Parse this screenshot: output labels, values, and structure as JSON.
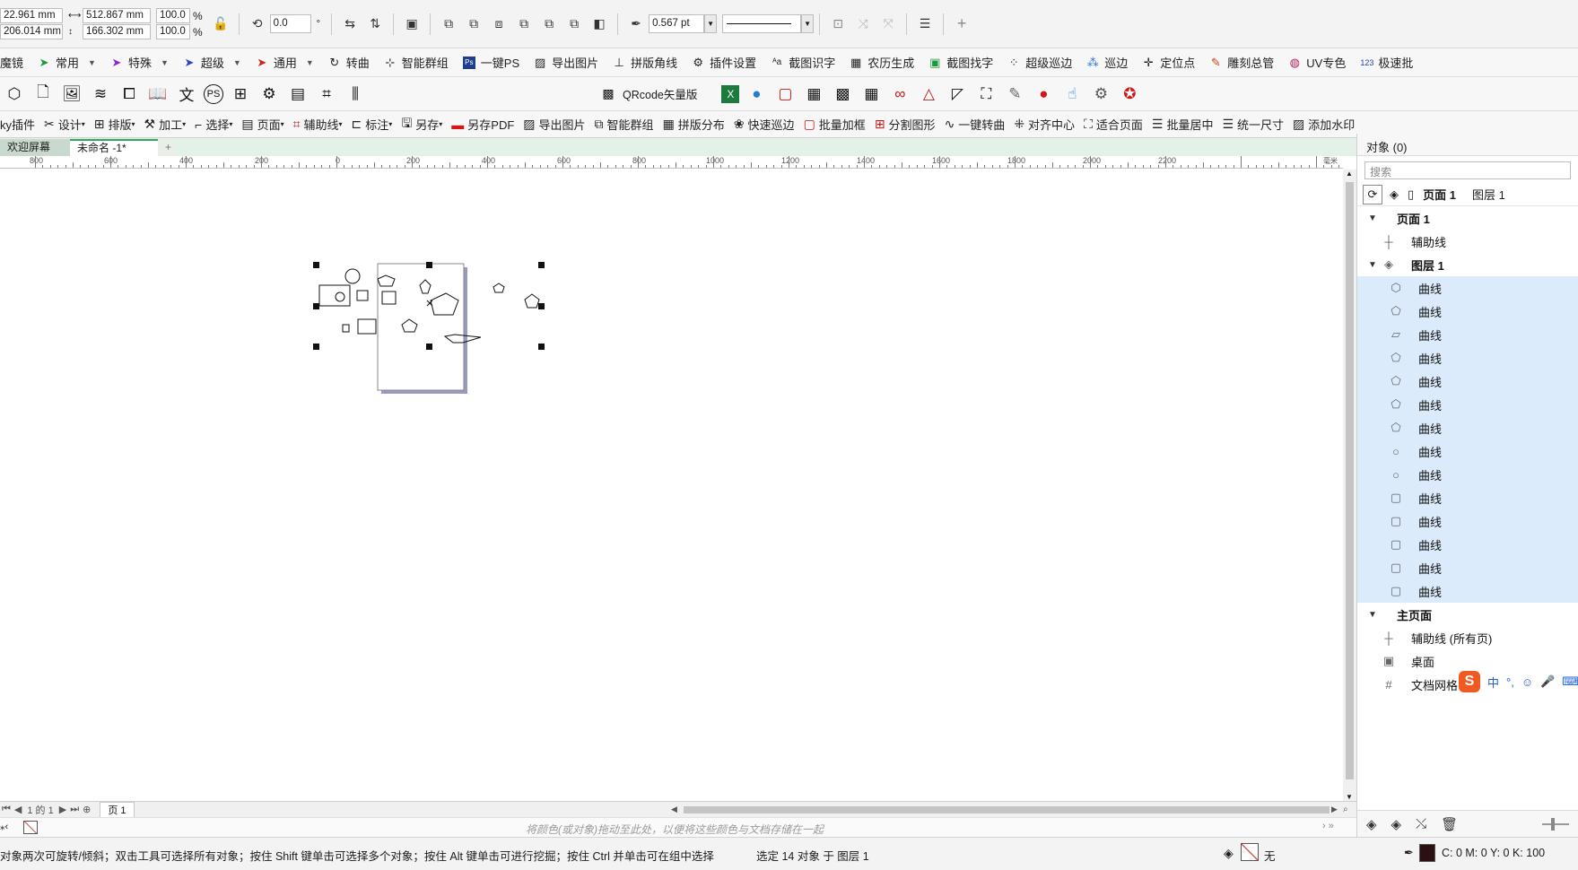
{
  "prop_bar": {
    "x": "22.961 mm",
    "y": "206.014 mm",
    "width": "512.867 mm",
    "height": "166.302 mm",
    "scale_x": "100.0",
    "scale_y": "100.0",
    "percent": "%",
    "rotation": "0.0",
    "degree": "°",
    "outline_width": "0.567 pt",
    "plus": "+"
  },
  "plugin_bar": {
    "items": [
      {
        "label": "魔镜",
        "icon": "mirror-icon",
        "caret": false
      },
      {
        "label": "常用",
        "icon": "arrow-icon",
        "caret": true
      },
      {
        "label": "特殊",
        "icon": "arrow-icon",
        "caret": true
      },
      {
        "label": "超级",
        "icon": "arrow-icon",
        "caret": true
      },
      {
        "label": "通用",
        "icon": "arrow-icon",
        "caret": true
      },
      {
        "label": "转曲",
        "icon": "convert-icon",
        "caret": false
      },
      {
        "label": "智能群组",
        "icon": "group-icon",
        "caret": false
      },
      {
        "label": "一键PS",
        "icon": "ps-icon",
        "caret": false
      },
      {
        "label": "导出图片",
        "icon": "image-icon",
        "caret": false
      },
      {
        "label": "拼版角线",
        "icon": "cropmark-icon",
        "caret": false
      },
      {
        "label": "插件设置",
        "icon": "gear-icon",
        "caret": false
      },
      {
        "label": "截图识字",
        "icon": "ocr-icon",
        "caret": false
      },
      {
        "label": "农历生成",
        "icon": "calendar-icon",
        "caret": false
      },
      {
        "label": "截图找字",
        "icon": "find-text-icon",
        "caret": false
      },
      {
        "label": "超级巡边",
        "icon": "patrol-icon",
        "caret": false
      },
      {
        "label": "巡边",
        "icon": "patrol-small-icon",
        "caret": false
      },
      {
        "label": "定位点",
        "icon": "locate-icon",
        "caret": false
      },
      {
        "label": "雕刻总管",
        "icon": "engrave-icon",
        "caret": false
      },
      {
        "label": "UV专色",
        "icon": "uv-icon",
        "caret": false
      },
      {
        "label": "极速批",
        "icon": "batch-icon",
        "caret": false
      }
    ]
  },
  "icon_bar": {
    "qrcode_label": "QRcode矢量版"
  },
  "tools_bar": {
    "items": [
      {
        "label": "ky插件",
        "icon": ""
      },
      {
        "label": "设计",
        "icon": "design-icon",
        "caret": true
      },
      {
        "label": "排版",
        "icon": "layout-icon",
        "caret": true
      },
      {
        "label": "加工",
        "icon": "process-icon",
        "caret": true
      },
      {
        "label": "选择",
        "icon": "select-icon",
        "caret": true
      },
      {
        "label": "页面",
        "icon": "page-icon",
        "caret": true
      },
      {
        "label": "辅助线",
        "icon": "guide-icon",
        "caret": true
      },
      {
        "label": "标注",
        "icon": "dimension-icon",
        "caret": true
      },
      {
        "label": "另存",
        "icon": "saveas-icon",
        "caret": true
      },
      {
        "label": "另存PDF",
        "icon": "pdf-icon"
      },
      {
        "label": "导出图片",
        "icon": "image-icon"
      },
      {
        "label": "智能群组",
        "icon": "group-icon"
      },
      {
        "label": "拼版分布",
        "icon": "grid-icon"
      },
      {
        "label": "快速巡边",
        "icon": "patrol-icon"
      },
      {
        "label": "批量加框",
        "icon": "frame-icon"
      },
      {
        "label": "分割图形",
        "icon": "split-icon"
      },
      {
        "label": "一键转曲",
        "icon": "curve-icon"
      },
      {
        "label": "对齐中心",
        "icon": "align-center-icon"
      },
      {
        "label": "适合页面",
        "icon": "fit-page-icon"
      },
      {
        "label": "批量居中",
        "icon": "center-icon"
      },
      {
        "label": "统一尺寸",
        "icon": "resize-icon"
      },
      {
        "label": "添加水印",
        "icon": "watermark-icon"
      }
    ]
  },
  "doc_tabs": {
    "welcome": "欢迎屏幕",
    "current": "未命名 -1*",
    "add": "+"
  },
  "ruler": {
    "labels": [
      "800",
      "600",
      "400",
      "200",
      "0",
      "200",
      "400",
      "600",
      "800",
      "1000",
      "1200",
      "1400",
      "1600",
      "1800",
      "2000",
      "2200"
    ],
    "unit": "毫米"
  },
  "page_nav": {
    "page_of": "1 的 1",
    "page_tab": "页 1"
  },
  "palette_bar": {
    "hint": "将颜色(或对象)拖动至此处，以便将这些颜色与文档存储在一起"
  },
  "status_bar": {
    "hint": "对象两次可旋转/倾斜；双击工具可选择所有对象；按住 Shift 键单击可选择多个对象；按住 Alt 键单击可进行挖掘；按住 Ctrl 并单击可在组中选择",
    "selection": "选定 14 对象 于 图层 1",
    "fill_none": "无",
    "cmyk": "C: 0 M: 0 Y: 0 K: 100"
  },
  "objects_panel": {
    "title": "对象 (0)",
    "search_placeholder": "搜索",
    "page_label": "页面 1",
    "layer_label": "图层 1",
    "tree": [
      {
        "label": "页面 1",
        "level": 0,
        "bold": true,
        "twisty": "▼",
        "icon": "",
        "selected": false
      },
      {
        "label": "辅助线",
        "level": 1,
        "bold": false,
        "twisty": "",
        "icon": "guides-icon",
        "selected": false
      },
      {
        "label": "图层 1",
        "level": 0,
        "bold": true,
        "twisty": "▼",
        "icon": "layer-icon",
        "selected": false
      },
      {
        "label": "曲线",
        "level": 2,
        "bold": false,
        "twisty": "",
        "icon": "hexagon-icon",
        "selected": true
      },
      {
        "label": "曲线",
        "level": 2,
        "bold": false,
        "twisty": "",
        "icon": "pentagon-icon",
        "selected": true
      },
      {
        "label": "曲线",
        "level": 2,
        "bold": false,
        "twisty": "",
        "icon": "flat-shape-icon",
        "selected": true
      },
      {
        "label": "曲线",
        "level": 2,
        "bold": false,
        "twisty": "",
        "icon": "pentagon-icon",
        "selected": true
      },
      {
        "label": "曲线",
        "level": 2,
        "bold": false,
        "twisty": "",
        "icon": "pentagon-icon",
        "selected": true
      },
      {
        "label": "曲线",
        "level": 2,
        "bold": false,
        "twisty": "",
        "icon": "pentagon-icon",
        "selected": true
      },
      {
        "label": "曲线",
        "level": 2,
        "bold": false,
        "twisty": "",
        "icon": "pentagon-icon",
        "selected": true
      },
      {
        "label": "曲线",
        "level": 2,
        "bold": false,
        "twisty": "",
        "icon": "circle-icon",
        "selected": true
      },
      {
        "label": "曲线",
        "level": 2,
        "bold": false,
        "twisty": "",
        "icon": "circle-icon",
        "selected": true
      },
      {
        "label": "曲线",
        "level": 2,
        "bold": false,
        "twisty": "",
        "icon": "rectangle-icon",
        "selected": true
      },
      {
        "label": "曲线",
        "level": 2,
        "bold": false,
        "twisty": "",
        "icon": "rectangle-icon",
        "selected": true
      },
      {
        "label": "曲线",
        "level": 2,
        "bold": false,
        "twisty": "",
        "icon": "rectangle-icon",
        "selected": true
      },
      {
        "label": "曲线",
        "level": 2,
        "bold": false,
        "twisty": "",
        "icon": "rectangle-icon",
        "selected": true
      },
      {
        "label": "曲线",
        "level": 2,
        "bold": false,
        "twisty": "",
        "icon": "rectangle-icon",
        "selected": true
      },
      {
        "label": "主页面",
        "level": 0,
        "bold": true,
        "twisty": "▼",
        "icon": "",
        "selected": false
      },
      {
        "label": "辅助线 (所有页)",
        "level": 1,
        "bold": false,
        "twisty": "",
        "icon": "guides-icon",
        "selected": false
      },
      {
        "label": "桌面",
        "level": 1,
        "bold": false,
        "twisty": "",
        "icon": "desktop-icon",
        "selected": false
      },
      {
        "label": "文档网格",
        "level": 1,
        "bold": false,
        "twisty": "",
        "icon": "grid-icon",
        "selected": false
      }
    ]
  },
  "ime": {
    "label": "中"
  },
  "colors": {
    "selection_bg": "#dcebfb",
    "tab_accent": "#2fa864",
    "page_shadow": "#9a9ac0"
  }
}
